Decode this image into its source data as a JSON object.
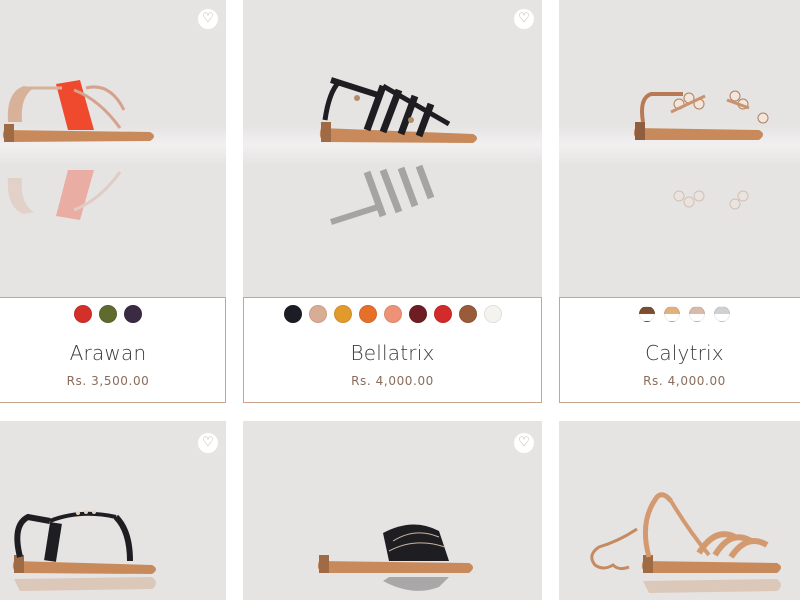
{
  "products": [
    {
      "name": "Arawan",
      "price": "Rs. 3,500.00",
      "wishlist_icon": "heart-icon",
      "swatches": [
        "#d3302a",
        "#5f6a2d",
        "#3a2a44"
      ]
    },
    {
      "name": "Bellatrix",
      "price": "Rs. 4,000.00",
      "wishlist_icon": "heart-icon",
      "swatches": [
        "#1c1c24",
        "#d8ad94",
        "#e39a2c",
        "#e6702a",
        "#ee9277",
        "#6e1d22",
        "#d32a2a",
        "#9a5b3a",
        "#f5f3ee"
      ]
    },
    {
      "name": "Calytrix",
      "price": "Rs. 4,000.00",
      "wishlist_icon": "heart-icon",
      "swatches": [
        "gradient-brown-white",
        "gradient-gold-white",
        "gradient-rose-white",
        "gradient-silver-white"
      ]
    },
    {
      "wishlist_icon": "heart-icon"
    },
    {
      "wishlist_icon": "heart-icon"
    },
    {}
  ],
  "colors": {
    "photo_background": "#e6e3e3",
    "card_border": "#c9a58c",
    "price_text": "#8a6c5a",
    "heart": "#b49a85"
  }
}
